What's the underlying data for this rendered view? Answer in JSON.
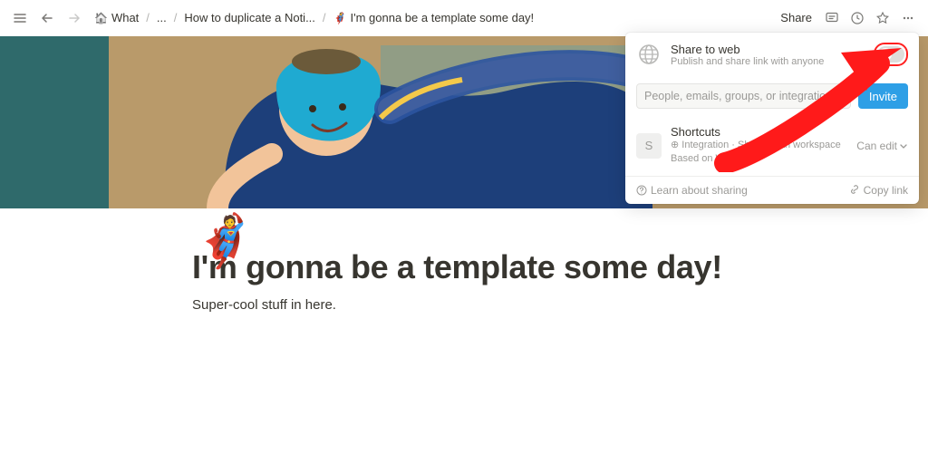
{
  "topbar": {
    "breadcrumbs": [
      {
        "icon": "🏠",
        "label": "What"
      },
      {
        "icon": "",
        "label": "..."
      },
      {
        "icon": "",
        "label": "How to duplicate a Noti..."
      },
      {
        "icon": "🦸",
        "label": "I'm gonna be a template some day!"
      }
    ],
    "share_label": "Share"
  },
  "page": {
    "icon": "🦸",
    "title": "I'm gonna be a template some day!",
    "body": "Super-cool stuff in here."
  },
  "share": {
    "share_to_web": "Share to web",
    "share_to_web_sub": "Publish and share link with anyone",
    "invite_placeholder": "People, emails, groups, or integrations",
    "invite_button": "Invite",
    "shortcut_badge": "S",
    "shortcut_title": "Shortcuts",
    "shortcut_sub_prefix": "⊕ Integration · Shared with workspace",
    "shortcut_based_on_prefix": "Based on ",
    "shortcut_based_on_link": "What",
    "can_edit": "Can edit",
    "learn": "Learn about sharing",
    "copy_link": "Copy link"
  }
}
